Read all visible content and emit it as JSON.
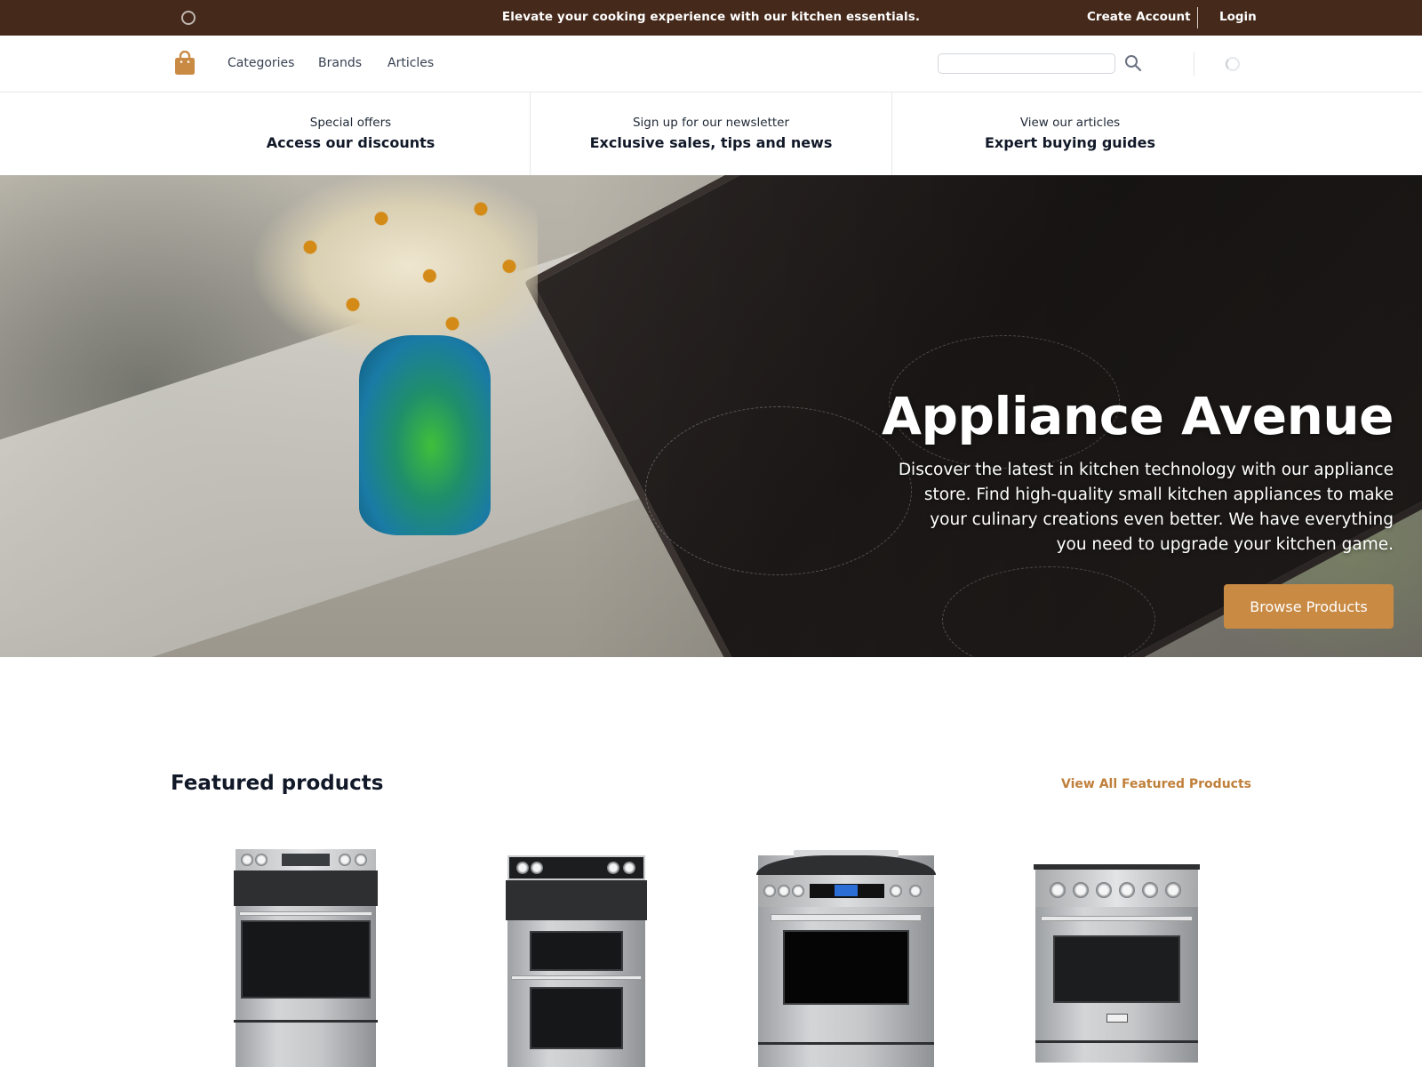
{
  "topbar": {
    "announcement": "Elevate your cooking experience with our kitchen essentials.",
    "create_account": "Create Account",
    "login": "Login",
    "loader_icon": "loading-ring-icon"
  },
  "nav": {
    "logo_icon": "shopping-bag-icon",
    "links": [
      {
        "label": "Categories"
      },
      {
        "label": "Brands"
      },
      {
        "label": "Articles"
      }
    ],
    "search": {
      "value": "",
      "placeholder": ""
    },
    "search_icon": "search-icon",
    "cart_icon": "loading-spinner-icon"
  },
  "promos": [
    {
      "eyebrow": "Special offers",
      "title": "Access our discounts"
    },
    {
      "eyebrow": "Sign up for our newsletter",
      "title": "Exclusive sales, tips and news"
    },
    {
      "eyebrow": "View our articles",
      "title": "Expert buying guides"
    }
  ],
  "hero": {
    "title": "Appliance Avenue",
    "description": "Discover the latest in kitchen technology with our appliance store. Find high-quality small kitchen appliances to make your culinary creations even better. We have everything you need to upgrade your kitchen game.",
    "cta": "Browse Products",
    "image": "kitchen countertop with flower vase, cooktop and knife block"
  },
  "featured": {
    "title": "Featured products",
    "view_all": "View All Featured Products",
    "products": [
      {
        "image": "stainless steel electric range (GE)"
      },
      {
        "image": "stainless steel double oven electric range (Whirlpool)"
      },
      {
        "image": "stainless steel induction range with digital display"
      },
      {
        "image": "stainless steel professional range (THOR)"
      }
    ]
  },
  "colors": {
    "topbar_bg": "#45291a",
    "accent": "#c98a44",
    "link_accent": "#c0803c",
    "text_dark": "#111827"
  }
}
